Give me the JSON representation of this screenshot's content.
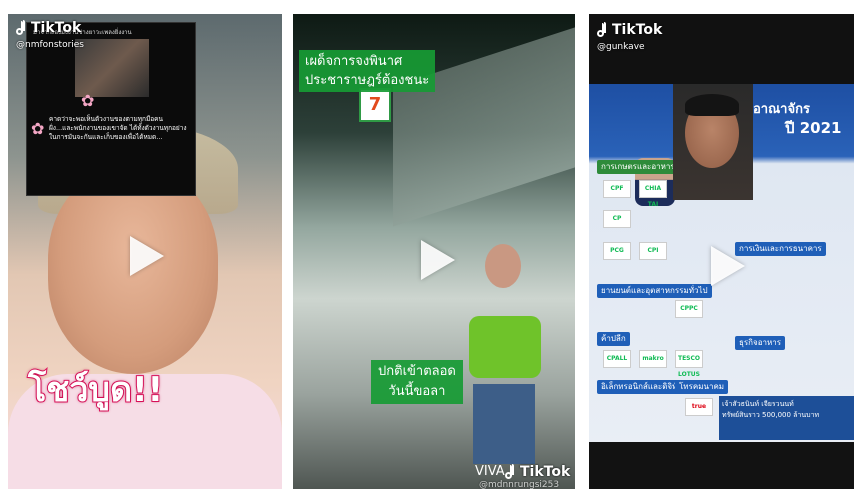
{
  "brand": {
    "tiktok_label": "TikTok",
    "green": "#1b9b34",
    "pink": "#e0125d"
  },
  "videos": [
    {
      "handle": "@nmfonstories",
      "caption_big": "โชว์บูด!!",
      "sticker_line": "มาจากลองมั้งงานช่างยาวะเพลงยิ่งงาน",
      "sticker_body": "คาดว่าจะพอเห็นตัวงานของตามทุกมือคนฝั่ง...และพนักงานของเขาจัด ได้ทั้งตัวงานทุกอย่างในการมันจะกันและเก็บของเพื่อได้หมด..."
    },
    {
      "banner_top": [
        "เผด็จการจงพินาศ",
        "ประชาราษฎร์ต้องชนะ"
      ],
      "banner_bottom": [
        "ปกติเข้าตลอด",
        "วันนี้ขอลา"
      ],
      "watermark": "VIVA",
      "handle_partial": "@mdnnrungsi253"
    },
    {
      "handle": "@gunkave",
      "headline_partial": "อาณาจักร",
      "year_partial": "ปี 2021",
      "sections": [
        "การเกษตรและอาหาร",
        "ยานยนต์และอุตสาหกรรมทั่วไป",
        "ค้าปลีก",
        "อิเล็กทรอนิกส์และดิจิทัล",
        "โทรคมนาคม",
        "การเงินและการธนาคาร",
        "ธุรกิจอาหาร"
      ],
      "logos": [
        "CPF",
        "CHIA TAI",
        "CP",
        "PCG",
        "CPI",
        "CPALL",
        "makro",
        "TESCO LOTUS",
        "true",
        "CPPC"
      ],
      "footer_lines": [
        "เจ้าสัวธนินท์ เจียรวนนท์",
        "ทรัพย์สินราว 500,000 ล้านบาท"
      ]
    }
  ]
}
